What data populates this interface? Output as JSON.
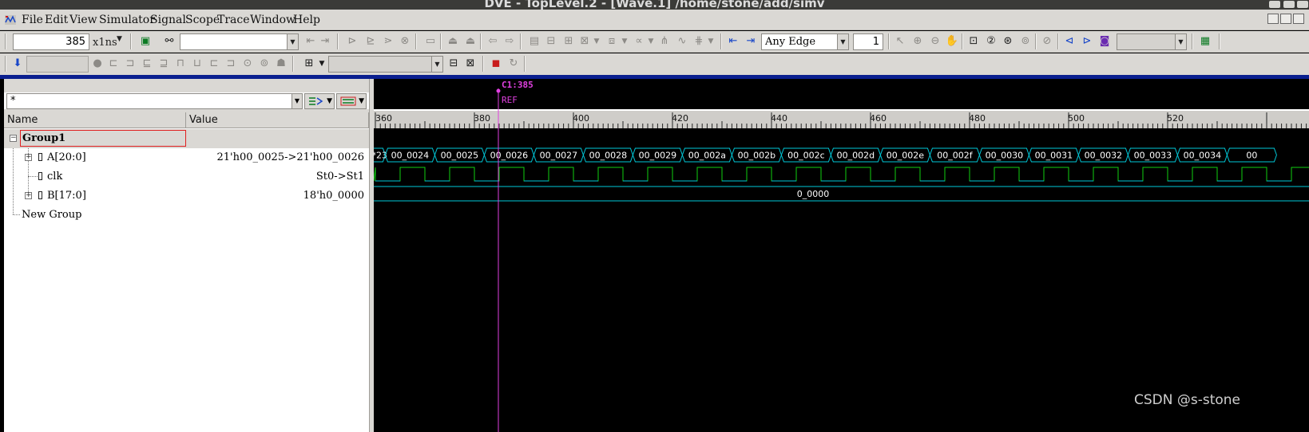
{
  "window": {
    "title": "DVE - TopLevel.2 - [Wave.1]  /home/stone/add/simv"
  },
  "menu": [
    "File",
    "Edit",
    "View",
    "Simulator",
    "Signal",
    "Scope",
    "Trace",
    "Window",
    "Help"
  ],
  "toolbar": {
    "time_value": "385",
    "time_unit": "x1ns",
    "search_value": "",
    "edge_select": "Any Edge",
    "edge_count": "1"
  },
  "signal_pane": {
    "filter_value": "*",
    "columns": {
      "name": "Name",
      "value": "Value"
    },
    "rows": [
      {
        "name": "Group1",
        "value": ""
      },
      {
        "name": "A[20:0]",
        "value": "21'h00_0025->21'h00_0026"
      },
      {
        "name": "clk",
        "value": "St0->St1"
      },
      {
        "name": "B[17:0]",
        "value": "18'h0_0000"
      },
      {
        "name": "New Group",
        "value": ""
      }
    ]
  },
  "wave": {
    "cursor_label": "C1:385",
    "ref_label": "REF",
    "ruler_ticks": [
      "360",
      "380",
      "400",
      "420",
      "440",
      "460",
      "480",
      "500",
      "520"
    ],
    "bus_a_values": [
      "*23",
      "00_0024",
      "00_0025",
      "00_0026",
      "00_0027",
      "00_0028",
      "00_0029",
      "00_002a",
      "00_002b",
      "00_002c",
      "00_002d",
      "00_002e",
      "00_002f",
      "00_0030",
      "00_0031",
      "00_0032",
      "00_0033",
      "00_0034",
      "00"
    ],
    "bus_b_value": "0_0000",
    "colors": {
      "bus": "#00c8d8",
      "clock": "#10d010",
      "cursor": "#e040e0"
    }
  },
  "watermark": "CSDN @s-stone"
}
